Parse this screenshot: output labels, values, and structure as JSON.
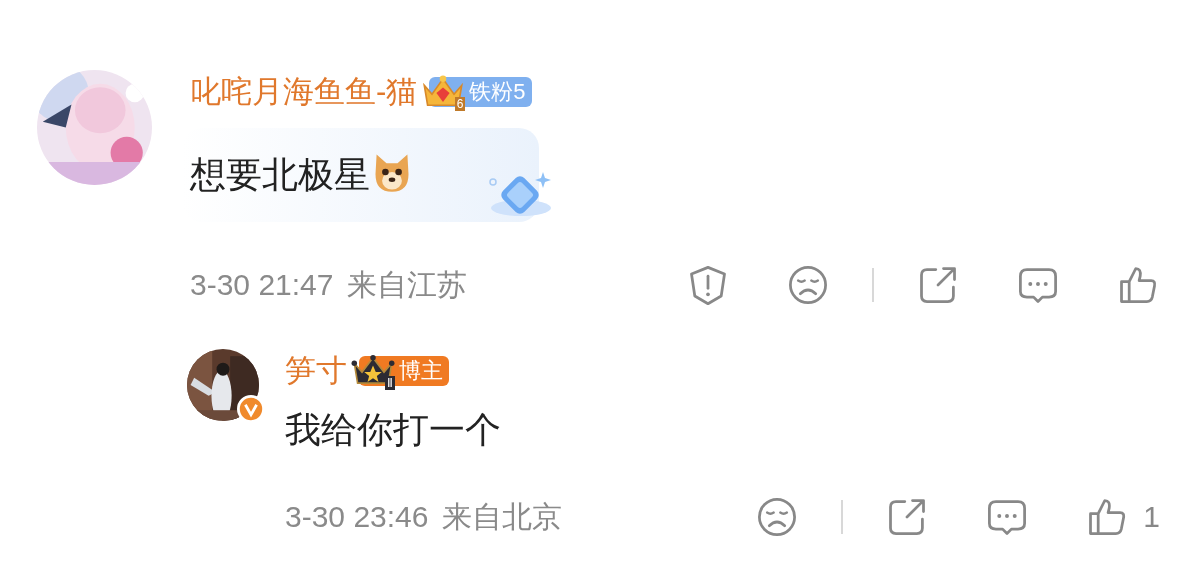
{
  "comments": [
    {
      "kind": "top",
      "verified": false,
      "name": "叱咤月海鱼鱼-猫",
      "badge": {
        "kind": "fan",
        "level_label": "6",
        "label": "铁粉5"
      },
      "text": "想要北极星",
      "sticker": true,
      "highlighted": true,
      "time": "3-30 21:47",
      "location": "来自江苏",
      "actions": [
        {
          "kind": "report"
        },
        {
          "kind": "dislike"
        },
        {
          "kind": "divider"
        },
        {
          "kind": "share"
        },
        {
          "kind": "comment"
        },
        {
          "kind": "like"
        }
      ]
    },
    {
      "kind": "reply",
      "verified": true,
      "name": "笋寸",
      "badge": {
        "kind": "author",
        "level_label": "Ⅱ",
        "label": "博主"
      },
      "text": "我给你打一个",
      "time": "3-30 23:46",
      "location": "来自北京",
      "actions": [
        {
          "kind": "dislike"
        },
        {
          "kind": "divider"
        },
        {
          "kind": "share"
        },
        {
          "kind": "comment"
        },
        {
          "kind": "like",
          "count": "1"
        }
      ]
    }
  ]
}
